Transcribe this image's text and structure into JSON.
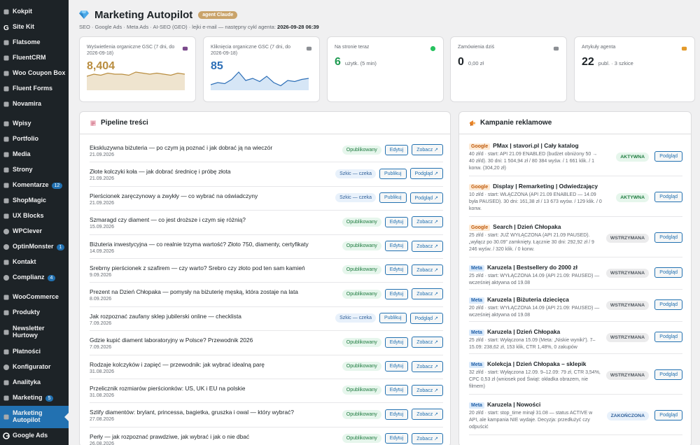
{
  "sidebar": {
    "items": [
      {
        "label": "Kokpit",
        "icon": "dashboard-icon"
      },
      {
        "label": "Site Kit",
        "icon": "sitekit-icon"
      },
      {
        "label": "Flatsome",
        "icon": "flatsome-icon"
      },
      {
        "label": "FluentCRM",
        "icon": "crm-icon"
      },
      {
        "label": "Woo Coupon Box",
        "icon": "coupon-icon"
      },
      {
        "label": "Fluent Forms",
        "icon": "forms-icon"
      },
      {
        "label": "Novamira",
        "icon": "novamira-icon"
      },
      {
        "label": "Wpisy",
        "icon": "pin-icon"
      },
      {
        "label": "Portfolio",
        "icon": "portfolio-icon"
      },
      {
        "label": "Media",
        "icon": "media-icon"
      },
      {
        "label": "Strony",
        "icon": "pages-icon"
      },
      {
        "label": "Komentarze",
        "icon": "comments-icon",
        "badge": "12"
      },
      {
        "label": "ShopMagic",
        "icon": "shopmagic-icon"
      },
      {
        "label": "UX Blocks",
        "icon": "blocks-icon"
      },
      {
        "label": "WPClever",
        "icon": "wpclever-icon"
      },
      {
        "label": "OptinMonster",
        "icon": "optinmonster-icon",
        "badge": "1"
      },
      {
        "label": "Kontakt",
        "icon": "contact-icon"
      },
      {
        "label": "Complianz",
        "icon": "complianz-icon",
        "badge": "4"
      },
      {
        "label": "WooCommerce",
        "icon": "woocommerce-icon"
      },
      {
        "label": "Produkty",
        "icon": "products-icon"
      },
      {
        "label": "Newsletter Hurtowy",
        "icon": "newsletter-icon"
      },
      {
        "label": "Płatności",
        "icon": "payments-icon"
      },
      {
        "label": "Konfigurator",
        "icon": "configurator-icon"
      },
      {
        "label": "Analityka",
        "icon": "analytics-icon"
      },
      {
        "label": "Marketing",
        "icon": "marketing-icon",
        "badge": "5"
      },
      {
        "label": "Marketing Autopilot",
        "icon": "autopilot-icon",
        "active": true
      },
      {
        "label": "Google Ads",
        "icon": "google-ads-icon"
      }
    ]
  },
  "header": {
    "title": "Marketing Autopilot",
    "badge": "agent Claude",
    "subtitle_prefix": "SEO · Google Ads · Meta Ads · AI-SEO (GEO) · lejki e-mail — następny cykl agenta:",
    "next_cycle": "2026-09-28 06:39"
  },
  "kpis": [
    {
      "label": "Wyświetlenia organiczne GSC (7 dni, do 2026-09-18)",
      "value": "8,404",
      "icon": "eye-icon",
      "color": "#b98d3f",
      "spark": [
        12,
        14,
        13,
        15,
        14,
        14,
        13,
        16,
        15,
        14,
        15,
        14,
        13,
        15,
        14
      ]
    },
    {
      "label": "Kliknięcia organiczne GSC (7 dni, do 2026-09-18)",
      "value": "85",
      "icon": "link-icon",
      "color": "#2d6fb7",
      "spark": [
        4,
        6,
        5,
        9,
        16,
        8,
        10,
        7,
        12,
        6,
        3,
        8,
        7,
        9,
        10
      ]
    },
    {
      "label": "Na stronie teraz",
      "value": "6",
      "unit": "użytk. (5 min)",
      "icon": "live-dot-icon",
      "color": "#1d9a50"
    },
    {
      "label": "Zamówienia dziś",
      "value": "0",
      "unit": "0,00 zł",
      "icon": "cart-icon",
      "color": "#1d2327"
    },
    {
      "label": "Artykuły agenta",
      "value": "22",
      "unit": "publ. · 3 szkice",
      "icon": "pen-icon",
      "color": "#1d2327"
    }
  ],
  "pipeline": {
    "title": "Pipeline treści",
    "rows": [
      {
        "title": "Ekskluzywna biżuteria — po czym ją poznać i jak dobrać ją na wieczór",
        "date": "21.09.2026",
        "status": "Opublikowany",
        "s": "pub",
        "b1": "Edytuj",
        "b2": "Zobacz ↗"
      },
      {
        "title": "Złote kolczyki koła — jak dobrać średnicę i próbę złota",
        "date": "21.09.2026",
        "status": "Szkic — czeka",
        "s": "draft",
        "b1": "Publikuj",
        "b2": "Podgląd ↗"
      },
      {
        "title": "Pierścionek zaręczynowy a zwykły — co wybrać na oświadczyny",
        "date": "21.09.2026",
        "status": "Szkic — czeka",
        "s": "draft",
        "b1": "Publikuj",
        "b2": "Podgląd ↗"
      },
      {
        "title": "Szmaragd czy diament — co jest droższe i czym się różnią?",
        "date": "15.09.2026",
        "status": "Opublikowany",
        "s": "pub",
        "b1": "Edytuj",
        "b2": "Zobacz ↗"
      },
      {
        "title": "Biżuteria inwestycyjna — co realnie trzyma wartość? Złoto 750, diamenty, certyfikaty",
        "date": "14.09.2026",
        "status": "Opublikowany",
        "s": "pub",
        "b1": "Edytuj",
        "b2": "Zobacz ↗"
      },
      {
        "title": "Srebrny pierścionek z szafirem — czy warto? Srebro czy złoto pod ten sam kamień",
        "date": "9.09.2026",
        "status": "Opublikowany",
        "s": "pub",
        "b1": "Edytuj",
        "b2": "Zobacz ↗"
      },
      {
        "title": "Prezent na Dzień Chłopaka — pomysły na biżuterię męską, która zostaje na lata",
        "date": "8.09.2026",
        "status": "Opublikowany",
        "s": "pub",
        "b1": "Edytuj",
        "b2": "Zobacz ↗"
      },
      {
        "title": "Jak rozpoznać zaufany sklep jubilerski online — checklista",
        "date": "7.09.2026",
        "status": "Szkic — czeka",
        "s": "draft",
        "b1": "Publikuj",
        "b2": "Podgląd ↗"
      },
      {
        "title": "Gdzie kupić diament laboratoryjny w Polsce? Przewodnik 2026",
        "date": "7.09.2026",
        "status": "Opublikowany",
        "s": "pub",
        "b1": "Edytuj",
        "b2": "Zobacz ↗"
      },
      {
        "title": "Rodzaje kolczyków i zapięć — przewodnik: jak wybrać idealną parę",
        "date": "31.08.2026",
        "status": "Opublikowany",
        "s": "pub",
        "b1": "Edytuj",
        "b2": "Zobacz ↗"
      },
      {
        "title": "Przelicznik rozmiarów pierścionków: US, UK i EU na polskie",
        "date": "31.08.2026",
        "status": "Opublikowany",
        "s": "pub",
        "b1": "Edytuj",
        "b2": "Zobacz ↗"
      },
      {
        "title": "Szlify diamentów: brylant, princessa, bagietka, gruszka i owal — który wybrać?",
        "date": "27.08.2026",
        "status": "Opublikowany",
        "s": "pub",
        "b1": "Edytuj",
        "b2": "Zobacz ↗"
      },
      {
        "title": "Perły — jak rozpoznać prawdziwe, jak wybrać i jak o nie dbać",
        "date": "26.08.2026",
        "status": "Opublikowany",
        "s": "pub",
        "b1": "Edytuj",
        "b2": "Zobacz ↗"
      }
    ]
  },
  "campaigns": {
    "title": "Kampanie reklamowe",
    "rows": [
      {
        "platform": "Google",
        "pf": "google",
        "name": "PMax | stavori.pl | Cały katalog",
        "desc": "40 zł/d · start: API 21.09 ENABLED (budżet obniżony 50 → 40 zł/d). 30 dni: 1 504,94 zł / 80 384 wyśw. / 1 661 klik. / 1 konw. (304,20 zł)",
        "status": "AKTYWNA",
        "s": "active",
        "btn": "Podgląd",
        "h": 58
      },
      {
        "platform": "Google",
        "pf": "google",
        "name": "Display | Remarketing | Odwiedzający",
        "desc": "10 zł/d · start: WŁĄCZONA (API 21.09 ENABLED — 14.09 była PAUSED). 30 dni: 161,38 zł / 13 673 wyśw. / 129 klik. / 0 konw.",
        "status": "AKTYWNA",
        "s": "active",
        "btn": "Podgląd",
        "h": 58
      },
      {
        "platform": "Google",
        "pf": "google",
        "name": "Search | Dzień Chłopaka",
        "desc": "25 zł/d · start: JUŻ WYŁĄCZONA (API 21.09 PAUSED). „wyłącz po 30.09” zamknięty. Łącznie 30 dni: 292,92 zł / 9 246 wyśw. / 320 klik. / 0 konw.",
        "status": "WSTRZYMANA",
        "s": "paused",
        "btn": "Podgląd",
        "h": 58
      },
      {
        "platform": "Meta",
        "pf": "meta",
        "name": "Karuzela | Bestsellery do 2000 zł",
        "desc": "25 zł/d · start: WYŁĄCZONA 14.09 (API 21.09: PAUSED) — wcześniej aktywna od 19.08",
        "status": "WSTRZYMANA",
        "s": "paused",
        "btn": "Podgląd",
        "h": 46
      },
      {
        "platform": "Meta",
        "pf": "meta",
        "name": "Karuzela | Biżuteria dziecięca",
        "desc": "20 zł/d · start: WYŁĄCZONA 14.09 (API 21.09: PAUSED) — wcześniej aktywna od 19.08",
        "status": "WSTRZYMANA",
        "s": "paused",
        "btn": "Podgląd",
        "h": 46
      },
      {
        "platform": "Meta",
        "pf": "meta",
        "name": "Karuzela | Dzień Chłopaka",
        "desc": "25 zł/d · start: Wyłączona 15.09 (Meta: „Niskie wyniki”). 7–15.09: 238,62 zł, 153 klik, CTR 1,48%, 0 zakupów",
        "status": "WSTRZYMANA",
        "s": "paused",
        "btn": "Podgląd",
        "h": 46
      },
      {
        "platform": "Meta",
        "pf": "meta",
        "name": "Kolekcja | Dzień Chłopaka – sklepik",
        "desc": "32 zł/d · start: Wyłączona 12.09. 9–12.09: 79 zł, CTR 3,54%, CPC 0,53 zł (wniosek pod Świąt: okładka obrazem, nie filmem)",
        "status": "WSTRZYMANA",
        "s": "paused",
        "btn": "Podgląd",
        "h": 58
      },
      {
        "platform": "Meta",
        "pf": "meta",
        "name": "Karuzela | Nowości",
        "desc": "20 zł/d · start: stop_time minął 31.08 — status ACTIVE w API, ale kampania NIE wydaje. Decyzja: przedłużyć czy odpuścić",
        "status": "ZAKOŃCZONA",
        "s": "ended",
        "btn": "Podgląd",
        "h": 58
      }
    ]
  }
}
